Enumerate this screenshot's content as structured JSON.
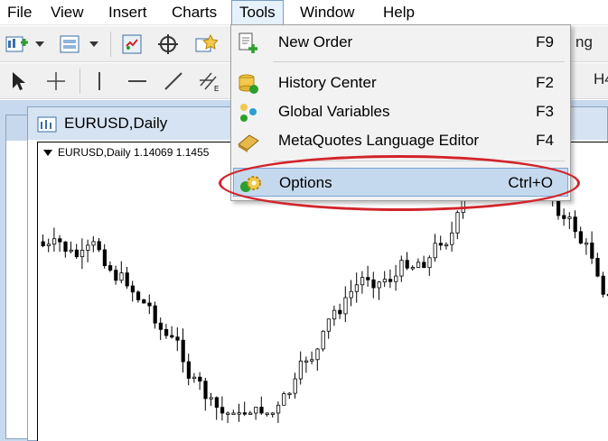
{
  "menubar": {
    "items": [
      "File",
      "View",
      "Insert",
      "Charts",
      "Tools",
      "Window",
      "Help"
    ],
    "active": "Tools"
  },
  "toolbar": {
    "partial_text_right": "ng",
    "partial_text_right2": "H4"
  },
  "chart_window": {
    "title": "EURUSD,Daily",
    "chart_label": "EURUSD,Daily  1.14069 1.1455"
  },
  "tools_menu": {
    "items": [
      {
        "label": "New Order",
        "shortcut": "F9",
        "icon": "new-order-icon"
      },
      {
        "label": "History Center",
        "shortcut": "F2",
        "icon": "history-center-icon"
      },
      {
        "label": "Global Variables",
        "shortcut": "F3",
        "icon": "global-variables-icon"
      },
      {
        "label": "MetaQuotes Language Editor",
        "shortcut": "F4",
        "icon": "metaeditor-icon"
      },
      {
        "label": "Options",
        "shortcut": "Ctrl+O",
        "icon": "options-gear-icon"
      }
    ],
    "highlighted": "Options"
  },
  "colors": {
    "highlight_ring": "#d2232a",
    "menu_highlight": "#c5d9ee",
    "mdi_background": "#c7d9ee"
  }
}
